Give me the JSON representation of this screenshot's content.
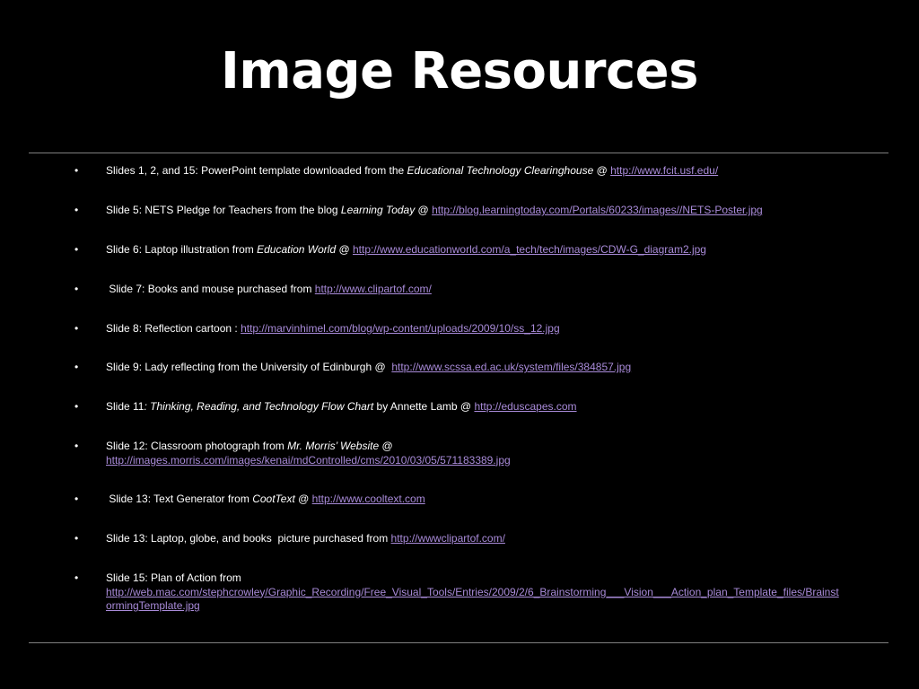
{
  "slide": {
    "title": "Image Resources",
    "colors": {
      "background": "#000000",
      "text": "#ffffff",
      "link": "#a98bd9",
      "rule": "#7f7f7f"
    }
  },
  "bullet_glyph": "•",
  "items": [
    {
      "pre": "Slides 1, 2, and 15: PowerPoint template downloaded from the ",
      "em": "Educational Technology Clearinghouse",
      "mid": " @ ",
      "link": "http://www.fcit.usf.edu/"
    },
    {
      "pre": "Slide 5: NETS Pledge for Teachers from the blog ",
      "em": "Learning Today",
      "mid": " @ ",
      "link": "http://blog.learningtoday.com/Portals/60233/images//NETS-Poster.jpg"
    },
    {
      "pre": "Slide 6: Laptop illustration from ",
      "em": "Education World",
      "mid": " @ ",
      "link": "http://www.educationworld.com/a_tech/tech/images/CDW-G_diagram2.jpg"
    },
    {
      "pre": " Slide 7: Books and mouse purchased from ",
      "em": "",
      "mid": "",
      "link": "http://www.clipartof.com/"
    },
    {
      "pre": "Slide 8: Reflection cartoon : ",
      "em": "",
      "mid": "",
      "link": "http://marvinhimel.com/blog/wp-content/uploads/2009/10/ss_12.jpg"
    },
    {
      "pre": "Slide 9: Lady reflecting from the University of Edinburgh @  ",
      "em": "",
      "mid": "",
      "link": "http://www.scssa.ed.ac.uk/system/files/384857.jpg"
    },
    {
      "pre": "Slide 11",
      "em": ": Thinking, Reading, and Technology Flow Chart",
      "mid": " by Annette Lamb @ ",
      "link": "http://eduscapes.com"
    },
    {
      "pre": "Slide 12: Classroom photograph from ",
      "em": "Mr. Morris’ Website",
      "mid": " @ ",
      "link": "http://images.morris.com/images/kenai/mdControlled/cms/2010/03/05/571183389.jpg"
    },
    {
      "pre": " Slide 13: Text Generator from ",
      "em": "CootText",
      "mid": " @ ",
      "link": "http://www.cooltext.com"
    },
    {
      "pre": "Slide 13: Laptop, globe, and books  picture purchased from ",
      "em": "",
      "mid": "",
      "link": "http://wwwclipartof.com/"
    },
    {
      "pre": "Slide 15: Plan of Action from ",
      "em": "",
      "mid": "",
      "link": "http://web.mac.com/stephcrowley/Graphic_Recording/Free_Visual_Tools/Entries/2009/2/6_Brainstorming___Vision___Action_plan_Template_files/BrainstormingTemplate.jpg"
    }
  ]
}
